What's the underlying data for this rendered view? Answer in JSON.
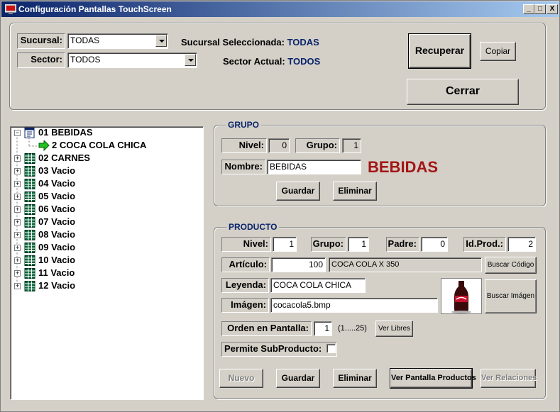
{
  "window": {
    "title": "Configuración Pantallas TouchScreen",
    "minimize": "_",
    "maximize": "□",
    "close": "X"
  },
  "filters": {
    "sucursal_label": "Sucursal:",
    "sucursal_value": "TODAS",
    "sector_label": "Sector:",
    "sector_value": "TODOS",
    "sucursal_seleccionada_label": "Sucursal Seleccionada:",
    "sucursal_seleccionada_value": "TODAS",
    "sector_actual_label": "Sector Actual:",
    "sector_actual_value": "TODOS",
    "recuperar_button": "Recuperar",
    "copiar_button": "Copiar",
    "cerrar_button": "Cerrar"
  },
  "tree": {
    "items": [
      {
        "label": "01 BEBIDAS",
        "expander": "−",
        "icon": "document-icon"
      },
      {
        "label": "2 COCA COLA CHICA",
        "expander": "",
        "icon": "green-arrow-icon"
      },
      {
        "label": "02 CARNES",
        "expander": "+",
        "icon": "grid-icon"
      },
      {
        "label": "03 Vacio",
        "expander": "+",
        "icon": "grid-icon"
      },
      {
        "label": "04 Vacio",
        "expander": "+",
        "icon": "grid-icon"
      },
      {
        "label": "05 Vacio",
        "expander": "+",
        "icon": "grid-icon"
      },
      {
        "label": "06 Vacio",
        "expander": "+",
        "icon": "grid-icon"
      },
      {
        "label": "07 Vacio",
        "expander": "+",
        "icon": "grid-icon"
      },
      {
        "label": "08 Vacio",
        "expander": "+",
        "icon": "grid-icon"
      },
      {
        "label": "09 Vacio",
        "expander": "+",
        "icon": "grid-icon"
      },
      {
        "label": "10 Vacio",
        "expander": "+",
        "icon": "grid-icon"
      },
      {
        "label": "11 Vacio",
        "expander": "+",
        "icon": "grid-icon"
      },
      {
        "label": "12 Vacio",
        "expander": "+",
        "icon": "grid-icon"
      }
    ]
  },
  "grupo": {
    "legend": "GRUPO",
    "nivel_label": "Nivel:",
    "nivel_value": "0",
    "grupo_label": "Grupo:",
    "grupo_value": "1",
    "nombre_label": "Nombre:",
    "nombre_value": "BEBIDAS",
    "nombre_display": "BEBIDAS",
    "guardar_button": "Guardar",
    "eliminar_button": "Eliminar",
    "display_color": "#a31515"
  },
  "producto": {
    "legend": "PRODUCTO",
    "nivel_label": "Nivel:",
    "nivel_value": "1",
    "grupo_label": "Grupo:",
    "grupo_value": "1",
    "padre_label": "Padre:",
    "padre_value": "0",
    "idprod_label": "Id.Prod.:",
    "idprod_value": "2",
    "articulo_label": "Artículo:",
    "articulo_code": "100",
    "articulo_desc": "COCA COLA X 350",
    "buscar_codigo_button": "Buscar Código",
    "leyenda_label": "Leyenda:",
    "leyenda_value": "COCA COLA CHICA",
    "imagen_label": "Imágen:",
    "imagen_value": "cocacola5.bmp",
    "buscar_imagen_button": "Buscar Imágen",
    "orden_label": "Orden en Pantalla:",
    "orden_value": "1",
    "orden_range": "(1.....25)",
    "ver_libres_button": "Ver Libres",
    "permite_label": "Permite SubProducto:",
    "permite_checked": false,
    "nuevo_button": "Nuevo",
    "guardar_button": "Guardar",
    "eliminar_button": "Eliminar",
    "ver_pantalla_button": "Ver Pantalla Productos",
    "ver_relaciones_button": "Ver Relaciones"
  }
}
